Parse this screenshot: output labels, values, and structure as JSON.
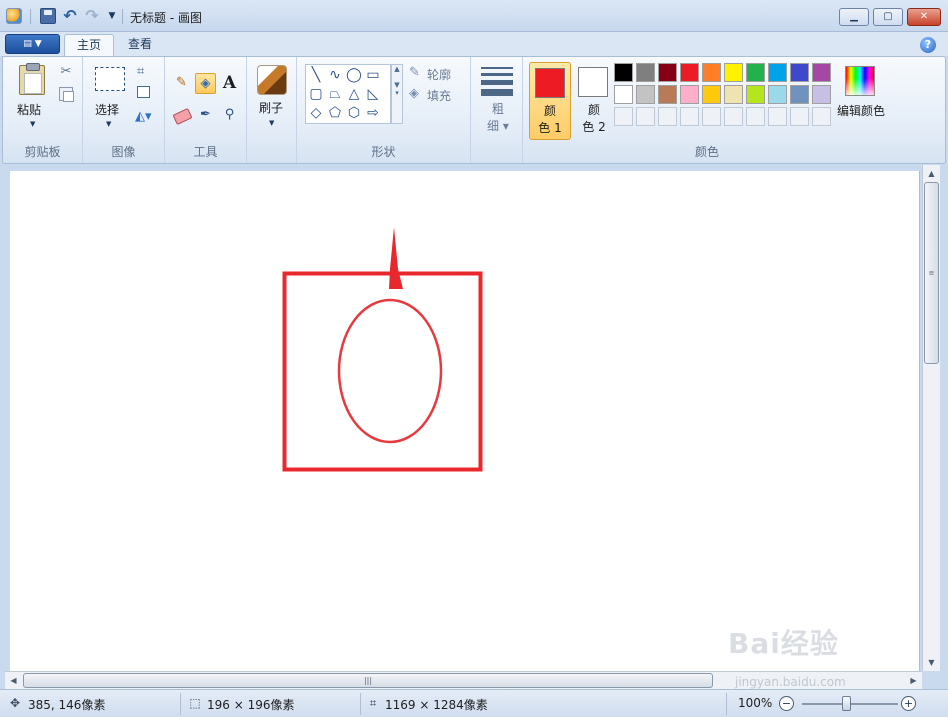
{
  "window": {
    "title": "无标题 - 画图"
  },
  "tabs": [
    {
      "label": "主页"
    },
    {
      "label": "查看"
    }
  ],
  "ribbon": {
    "clipboard": {
      "paste": "粘贴",
      "group": "剪贴板"
    },
    "image": {
      "select": "选择",
      "group": "图像"
    },
    "tools": {
      "group": "工具",
      "text_glyph": "A"
    },
    "brush": {
      "label": "刷子"
    },
    "shapes": {
      "outline": "轮廓",
      "fill": "填充",
      "group": "形状"
    },
    "size": {
      "label_line1": "粗",
      "label_line2": "细"
    },
    "colors": {
      "color1_line1": "颜",
      "color1_line2": "色 1",
      "color2_line1": "颜",
      "color2_line2": "色 2",
      "edit": "编辑颜色",
      "group": "颜色",
      "color1_value": "#ed1c24",
      "color2_value": "#ffffff",
      "palette_row1": [
        "#000000",
        "#7f7f7f",
        "#880015",
        "#ed1c24",
        "#ff7f27",
        "#fff200",
        "#22b14c",
        "#00a2e8",
        "#3f48cc",
        "#a349a4"
      ],
      "palette_row2": [
        "#ffffff",
        "#c3c3c3",
        "#b97a57",
        "#ffaec9",
        "#ffc90e",
        "#efe4b0",
        "#b5e61d",
        "#99d9ea",
        "#7092be",
        "#c8bfe7"
      ]
    }
  },
  "canvas": {
    "drawing_color": "#e8282c",
    "ellipse_color": "#e63a3f"
  },
  "statusbar": {
    "cursor_pos": "385, 146像素",
    "selection_size": "196 × 196像素",
    "image_size": "1169 × 1284像素",
    "zoom": "100%"
  },
  "watermark": {
    "text": "Bai经验",
    "url": "jingyan.baidu.com"
  }
}
